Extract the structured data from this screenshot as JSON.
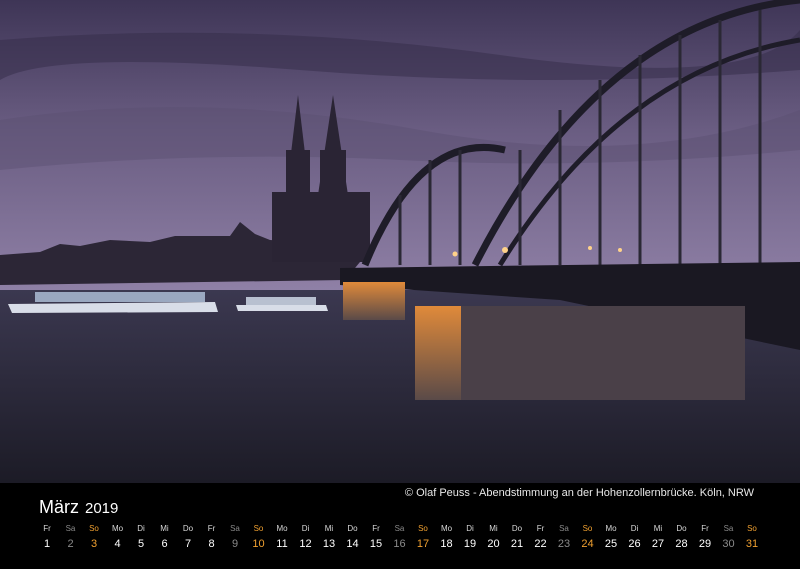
{
  "calendar": {
    "month": "März",
    "year": "2019",
    "caption": "© Olaf Peuss - Abendstimmung an der Hohenzollernbrücke. Köln, NRW",
    "days": [
      {
        "dow": "Fr",
        "num": "1",
        "kind": "weekday"
      },
      {
        "dow": "Sa",
        "num": "2",
        "kind": "sat"
      },
      {
        "dow": "So",
        "num": "3",
        "kind": "sun"
      },
      {
        "dow": "Mo",
        "num": "4",
        "kind": "weekday"
      },
      {
        "dow": "Di",
        "num": "5",
        "kind": "weekday"
      },
      {
        "dow": "Mi",
        "num": "6",
        "kind": "weekday"
      },
      {
        "dow": "Do",
        "num": "7",
        "kind": "weekday"
      },
      {
        "dow": "Fr",
        "num": "8",
        "kind": "weekday"
      },
      {
        "dow": "Sa",
        "num": "9",
        "kind": "sat"
      },
      {
        "dow": "So",
        "num": "10",
        "kind": "sun"
      },
      {
        "dow": "Mo",
        "num": "11",
        "kind": "weekday"
      },
      {
        "dow": "Di",
        "num": "12",
        "kind": "weekday"
      },
      {
        "dow": "Mi",
        "num": "13",
        "kind": "weekday"
      },
      {
        "dow": "Do",
        "num": "14",
        "kind": "weekday"
      },
      {
        "dow": "Fr",
        "num": "15",
        "kind": "weekday"
      },
      {
        "dow": "Sa",
        "num": "16",
        "kind": "sat"
      },
      {
        "dow": "So",
        "num": "17",
        "kind": "sun"
      },
      {
        "dow": "Mo",
        "num": "18",
        "kind": "weekday"
      },
      {
        "dow": "Di",
        "num": "19",
        "kind": "weekday"
      },
      {
        "dow": "Mi",
        "num": "20",
        "kind": "weekday"
      },
      {
        "dow": "Do",
        "num": "21",
        "kind": "weekday"
      },
      {
        "dow": "Fr",
        "num": "22",
        "kind": "weekday"
      },
      {
        "dow": "Sa",
        "num": "23",
        "kind": "sat"
      },
      {
        "dow": "So",
        "num": "24",
        "kind": "sun"
      },
      {
        "dow": "Mo",
        "num": "25",
        "kind": "weekday"
      },
      {
        "dow": "Di",
        "num": "26",
        "kind": "weekday"
      },
      {
        "dow": "Mi",
        "num": "27",
        "kind": "weekday"
      },
      {
        "dow": "Do",
        "num": "28",
        "kind": "weekday"
      },
      {
        "dow": "Fr",
        "num": "29",
        "kind": "weekday"
      },
      {
        "dow": "Sa",
        "num": "30",
        "kind": "sat"
      },
      {
        "dow": "So",
        "num": "31",
        "kind": "sun"
      }
    ]
  },
  "colors": {
    "sky_top": "#4a3f60",
    "sky_bottom": "#8a7ba0",
    "water": "#2a2838",
    "sunday": "#f0a030",
    "saturday": "#8a8a8a",
    "background": "#000000"
  }
}
